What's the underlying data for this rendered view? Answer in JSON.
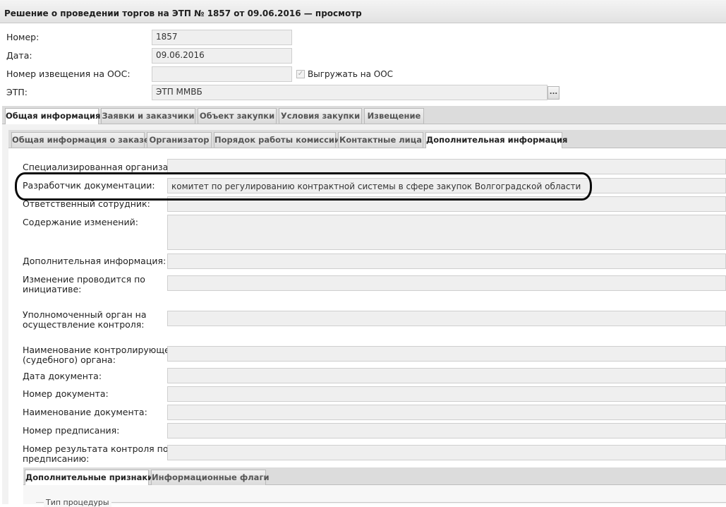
{
  "window": {
    "title": "Решение о проведении торгов на ЭТП № 1857 от 09.06.2016 — просмотр"
  },
  "header": {
    "number_label": "Номер:",
    "number_value": "1857",
    "date_label": "Дата:",
    "date_value": "09.06.2016",
    "notice_label": "Номер извещения на ООС:",
    "notice_value": "",
    "export_label": "Выгружать на ООС",
    "export_checked": true,
    "etp_label": "ЭТП:",
    "etp_value": "ЭТП ММВБ",
    "etp_button": "..."
  },
  "main_tabs": [
    {
      "label": "Общая информация",
      "active": true
    },
    {
      "label": "Заявки и заказчики",
      "active": false
    },
    {
      "label": "Объект закупки",
      "active": false
    },
    {
      "label": "Условия закупки",
      "active": false
    },
    {
      "label": "Извещение",
      "active": false
    }
  ],
  "sub_tabs": [
    {
      "label": "Общая информация о заказе",
      "active": false
    },
    {
      "label": "Организатор",
      "active": false
    },
    {
      "label": "Порядок работы комиссии",
      "active": false
    },
    {
      "label": "Контактные лица",
      "active": false
    },
    {
      "label": "Дополнительная информация",
      "active": true
    }
  ],
  "form": {
    "specialized_org_label": "Специализированная организация:",
    "specialized_org_value": "",
    "doc_developer_label": "Разработчик документации:",
    "doc_developer_value": "комитет по регулированию контрактной системы в сфере закупок Волгоградской области",
    "responsible_label": "Ответственный сотрудник:",
    "responsible_value": "",
    "changes_label": "Содержание изменений:",
    "changes_value": "",
    "additional_label": "Дополнительная информация:",
    "additional_value": "",
    "initiative_label_1": "Изменение проводится по",
    "initiative_label_2": "инициативе:",
    "initiative_value": "",
    "control_body_label_1": "Уполномоченный орган на",
    "control_body_label_2": "осуществление контроля:",
    "control_body_value": "",
    "judicial_label_1": "Наименование контролирующего",
    "judicial_label_2": "(судебного) органа:",
    "judicial_value": "",
    "doc_date_label": "Дата документа:",
    "doc_date_value": "",
    "doc_number_label": "Номер документа:",
    "doc_number_value": "",
    "doc_name_label": "Наименование документа:",
    "doc_name_value": "",
    "order_number_label": "Номер предписания:",
    "order_number_value": "",
    "control_result_label_1": "Номер результата контроля по",
    "control_result_label_2": "предписанию:",
    "control_result_value": ""
  },
  "bottom_tabs": [
    {
      "label": "Дополнительные признаки",
      "active": true
    },
    {
      "label": "Информационные флаги",
      "active": false
    }
  ],
  "procedure_section": {
    "label": "Тип процедуры"
  }
}
